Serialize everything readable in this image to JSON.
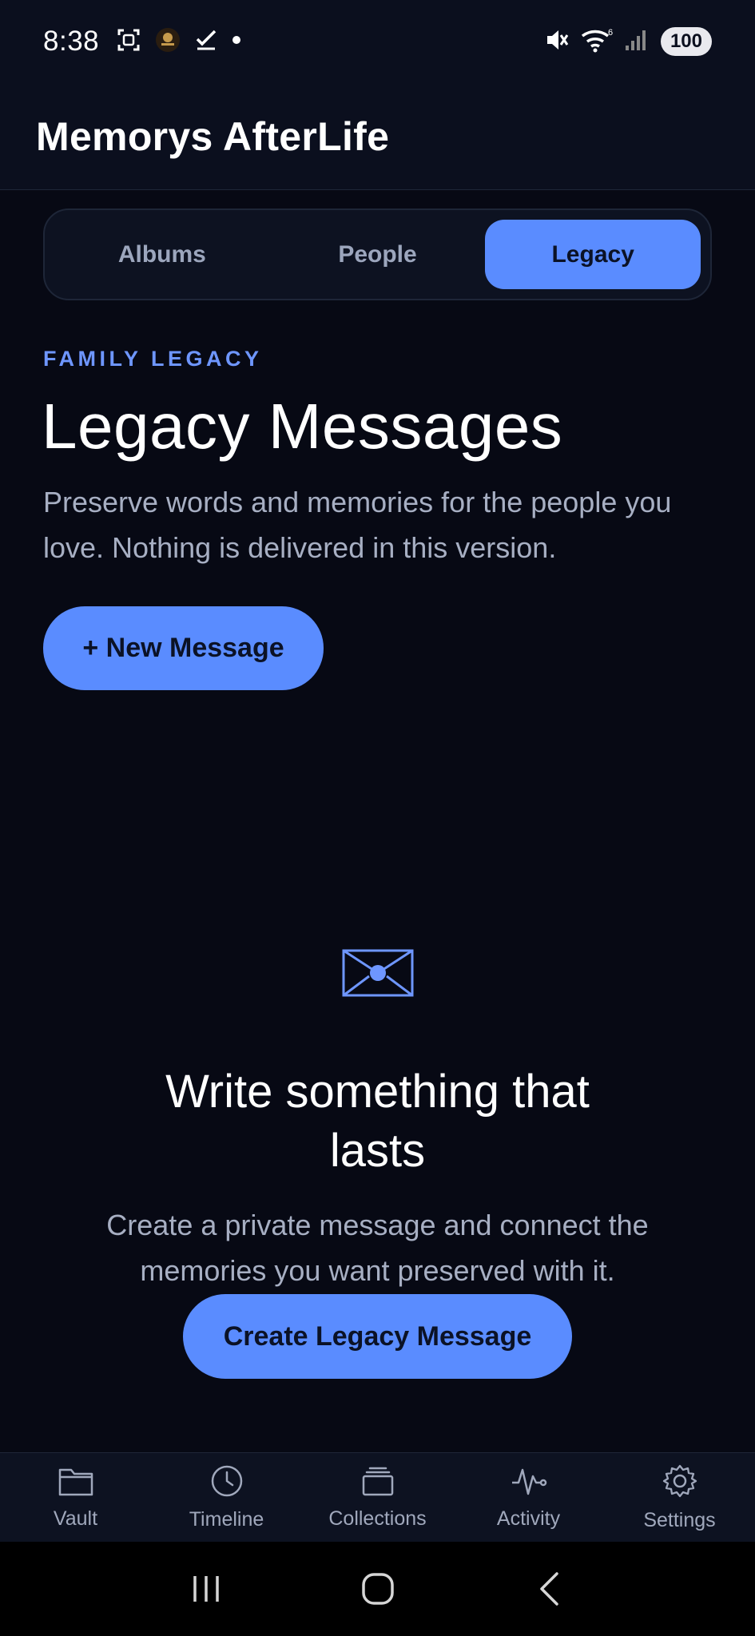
{
  "status_bar": {
    "time": "8:38",
    "battery": "100",
    "icons": [
      "screenshot-icon",
      "app-avatar-icon",
      "check-icon",
      "dot-icon",
      "mute-icon",
      "wifi-icon",
      "signal-icon",
      "battery-icon"
    ]
  },
  "app": {
    "title": "Memorys AfterLife"
  },
  "tabs": [
    {
      "label": "Albums",
      "active": false
    },
    {
      "label": "People",
      "active": false
    },
    {
      "label": "Legacy",
      "active": true
    }
  ],
  "header": {
    "eyebrow": "FAMILY LEGACY",
    "title": "Legacy Messages",
    "description": "Preserve words and memories for the people you love. Nothing is delivered in this version.",
    "new_button_label": "+ New Message"
  },
  "empty_state": {
    "icon": "envelope-icon",
    "title": "Write something that lasts",
    "description": "Create a private message and connect the memories you want preserved with it.",
    "button_label": "Create Legacy Message"
  },
  "bottom_nav": [
    {
      "label": "Vault",
      "icon": "folder-icon"
    },
    {
      "label": "Timeline",
      "icon": "clock-icon"
    },
    {
      "label": "Collections",
      "icon": "collections-icon"
    },
    {
      "label": "Activity",
      "icon": "pulse-icon"
    },
    {
      "label": "Settings",
      "icon": "gear-icon"
    }
  ],
  "colors": {
    "accent": "#5a8cff",
    "background": "#070914",
    "surface": "#0d1221",
    "muted_text": "#a7afc3"
  }
}
